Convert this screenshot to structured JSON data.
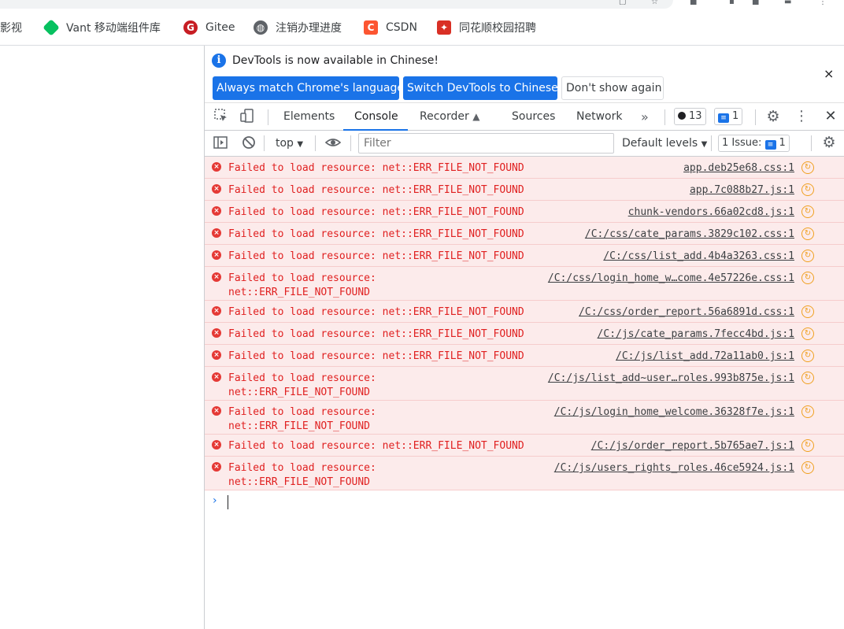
{
  "bookmarks": [
    {
      "label": "蝴蝶影视",
      "icon": "video-icon",
      "color": "#3c4043"
    },
    {
      "label": "Vant 移动端组件库",
      "icon": "vant-icon",
      "color": "#07c160"
    },
    {
      "label": "Gitee",
      "icon": "gitee-icon",
      "color": "#c71d23"
    },
    {
      "label": "注销办理进度",
      "icon": "globe-icon",
      "color": "#5f6368"
    },
    {
      "label": "CSDN",
      "icon": "csdn-icon",
      "color": "#fc5531"
    },
    {
      "label": "同花顺校园招聘",
      "icon": "tonghuashun-icon",
      "color": "#d93025"
    }
  ],
  "infobar": {
    "message": "DevTools is now available in Chinese!",
    "btn_match": "Always match Chrome's language",
    "btn_switch": "Switch DevTools to Chinese",
    "btn_dont_show": "Don't show again",
    "close": "×"
  },
  "tabs": {
    "elements": "Elements",
    "console": "Console",
    "recorder": "Recorder",
    "sources": "Sources",
    "network": "Network",
    "more": "»",
    "errors_count": "13",
    "messages_count": "1"
  },
  "toolbar": {
    "context": "top",
    "filter_placeholder": "Filter",
    "levels": "Default levels",
    "issues": "1 Issue:",
    "issues_count": "1"
  },
  "console": {
    "entries": [
      {
        "message": "Failed to load resource: net::ERR_FILE_NOT_FOUND",
        "source": "app.deb25e68.css:1"
      },
      {
        "message": "Failed to load resource: net::ERR_FILE_NOT_FOUND",
        "source": "app.7c088b27.js:1"
      },
      {
        "message": "Failed to load resource: net::ERR_FILE_NOT_FOUND",
        "source": "chunk-vendors.66a02cd8.js:1"
      },
      {
        "message": "Failed to load resource: net::ERR_FILE_NOT_FOUND",
        "source": "/C:/css/cate_params.3829c102.css:1"
      },
      {
        "message": "Failed to load resource: net::ERR_FILE_NOT_FOUND",
        "source": "/C:/css/list_add.4b4a3263.css:1"
      },
      {
        "message": "Failed to load resource:\nnet::ERR_FILE_NOT_FOUND",
        "source": "/C:/css/login_home_w…come.4e57226e.css:1"
      },
      {
        "message": "Failed to load resource: net::ERR_FILE_NOT_FOUND",
        "source": "/C:/css/order_report.56a6891d.css:1"
      },
      {
        "message": "Failed to load resource: net::ERR_FILE_NOT_FOUND",
        "source": "/C:/js/cate_params.7fecc4bd.js:1"
      },
      {
        "message": "Failed to load resource: net::ERR_FILE_NOT_FOUND",
        "source": "/C:/js/list_add.72a11ab0.js:1"
      },
      {
        "message": "Failed to load resource:\nnet::ERR_FILE_NOT_FOUND",
        "source": "/C:/js/list_add~user…roles.993b875e.js:1"
      },
      {
        "message": "Failed to load resource:\nnet::ERR_FILE_NOT_FOUND",
        "source": "/C:/js/login_home_welcome.36328f7e.js:1"
      },
      {
        "message": "Failed to load resource: net::ERR_FILE_NOT_FOUND",
        "source": "/C:/js/order_report.5b765ae7.js:1"
      },
      {
        "message": "Failed to load resource:\nnet::ERR_FILE_NOT_FOUND",
        "source": "/C:/js/users_rights_roles.46ce5924.js:1"
      }
    ],
    "prompt": "›"
  },
  "colors": {
    "accent": "#1a73e8",
    "error_text": "#e02020",
    "error_bg": "#fcebeb"
  }
}
